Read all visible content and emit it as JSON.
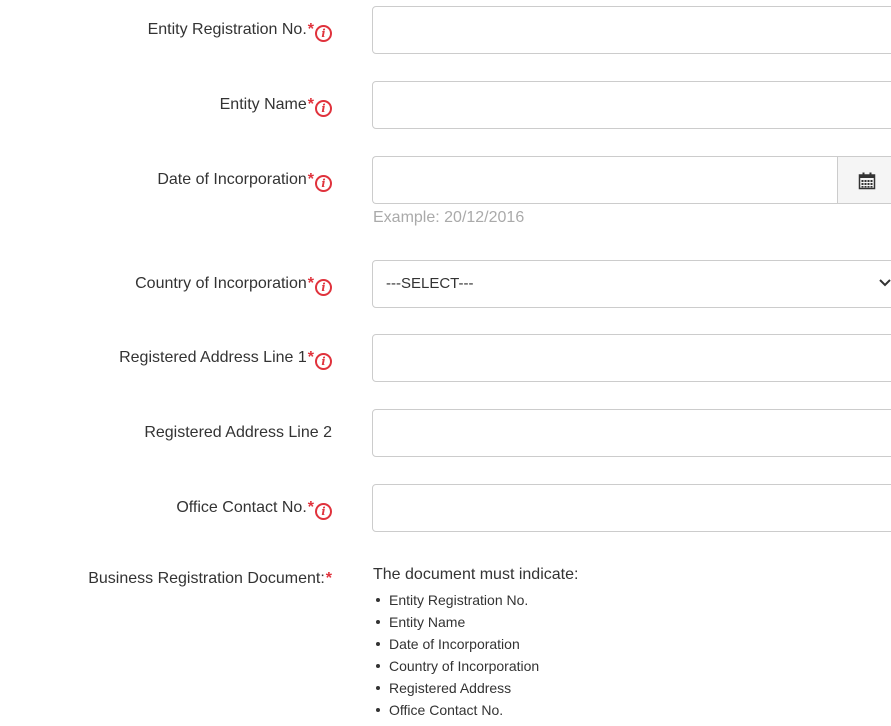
{
  "fields": {
    "entity_reg_no": {
      "label": "Entity Registration No.",
      "required": "*",
      "value": ""
    },
    "entity_name": {
      "label": "Entity Name",
      "required": "*",
      "value": ""
    },
    "date_of_incorporation": {
      "label": "Date of Incorporation",
      "required": "*",
      "value": "",
      "hint": "Example: 20/12/2016"
    },
    "country_of_incorporation": {
      "label": "Country of Incorporation",
      "required": "*",
      "selected": "---SELECT---"
    },
    "reg_address_1": {
      "label": "Registered Address Line 1",
      "required": "*",
      "value": ""
    },
    "reg_address_2": {
      "label": "Registered Address Line 2",
      "value": ""
    },
    "office_contact": {
      "label": "Office Contact No.",
      "required": "*",
      "value": ""
    }
  },
  "info_glyph": "i",
  "business_doc": {
    "label": "Business Registration Document:",
    "required": "*",
    "title": "The document must indicate:",
    "items": [
      "Entity Registration No.",
      "Entity Name",
      "Date of Incorporation",
      "Country of Incorporation",
      "Registered Address",
      "Office Contact No."
    ]
  },
  "icons": {
    "info": "info-icon",
    "calendar": "calendar-icon",
    "dropdown": "chevron-down-icon"
  },
  "colors": {
    "required": "#e0323c",
    "border": "#cccccc",
    "hint": "#aaaaaa",
    "text": "#333333"
  }
}
